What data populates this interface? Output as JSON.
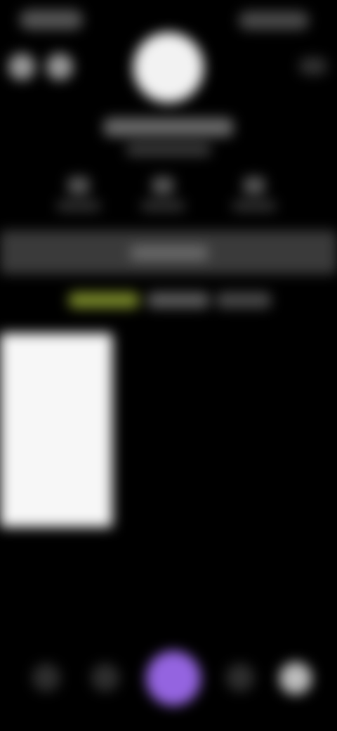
{
  "status_bar": {
    "time": "",
    "indicators": ""
  },
  "header": {
    "left_icons": [
      "back-icon",
      "share-icon"
    ],
    "right_icon": "menu-icon"
  },
  "profile": {
    "avatar_icon": "avatar-image",
    "username": "",
    "subtitle": ""
  },
  "stats": [
    {
      "value": "",
      "label": ""
    },
    {
      "value": "",
      "label": ""
    },
    {
      "value": "",
      "label": ""
    }
  ],
  "action_bar": {
    "label": ""
  },
  "tabs": [
    {
      "label": "",
      "active": true
    },
    {
      "label": "",
      "active": false
    },
    {
      "label": "",
      "active": false
    }
  ],
  "posts": [
    {
      "thumbnail": "post-thumbnail"
    }
  ],
  "bottom_nav": {
    "items": [
      {
        "icon": "home-icon"
      },
      {
        "icon": "search-icon"
      },
      {
        "icon": "create-icon"
      },
      {
        "icon": "inbox-icon"
      },
      {
        "icon": "profile-icon"
      }
    ]
  },
  "colors": {
    "background": "#000000",
    "active_tab": "#7a8a2a",
    "create_button": "#9464e0",
    "action_bar": "#3a3a3a",
    "thumbnail": "#f7f7f7"
  }
}
